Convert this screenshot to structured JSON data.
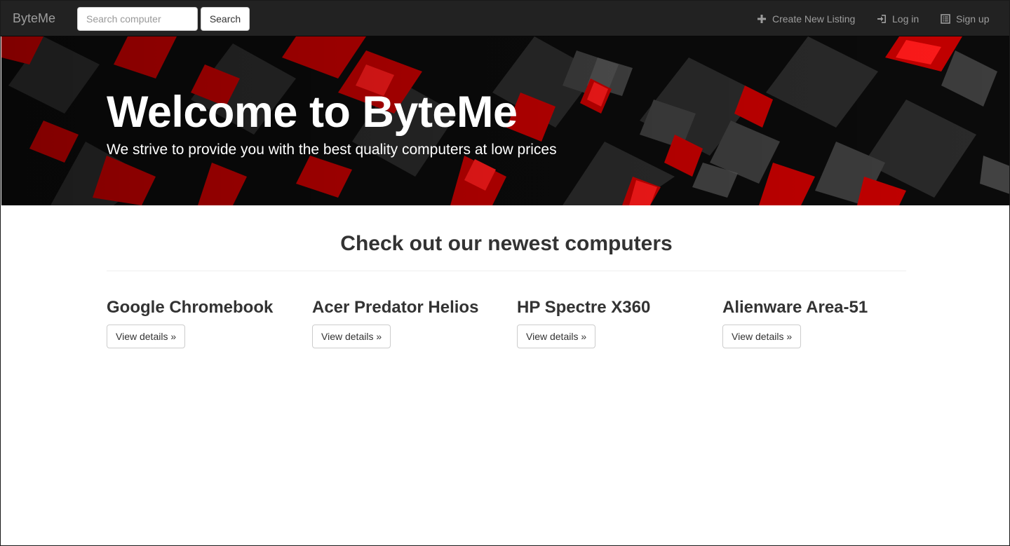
{
  "navbar": {
    "brand": "ByteMe",
    "search": {
      "placeholder": "Search computer",
      "value": ""
    },
    "search_button": "Search",
    "links": [
      {
        "label": "Create New Listing",
        "icon": "plus-icon"
      },
      {
        "label": "Log in",
        "icon": "log-in-icon"
      },
      {
        "label": "Sign up",
        "icon": "list-alt-icon"
      }
    ]
  },
  "hero": {
    "title": "Welcome to ByteMe",
    "subtitle": "We strive to provide you with the best quality computers at low prices"
  },
  "section": {
    "title": "Check out our newest computers"
  },
  "products": [
    {
      "name": "Google Chromebook",
      "button": "View details »"
    },
    {
      "name": "Acer Predator Helios",
      "button": "View details »"
    },
    {
      "name": "HP Spectre X360",
      "button": "View details »"
    },
    {
      "name": "Alienware Area-51",
      "button": "View details »"
    }
  ],
  "colors": {
    "navbar_bg": "#222222",
    "nav_text": "#9d9d9d",
    "hero_accent": "#d10000",
    "hero_dark": "#0a0a0a"
  }
}
